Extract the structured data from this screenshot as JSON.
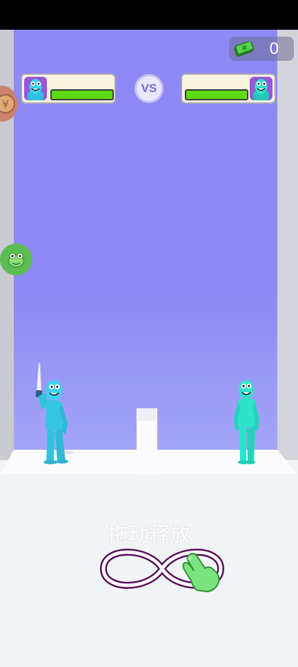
{
  "hud": {
    "money_icon": "cash-icon",
    "money_value": "0",
    "vs_label": "VS"
  },
  "player": {
    "hp_fraction": 1.0,
    "avatar_color": "#9a56d6",
    "body_color": "#3ccde3"
  },
  "enemy": {
    "hp_fraction": 1.0,
    "avatar_color": "#9a56d6",
    "body_color": "#2ee3cc"
  },
  "side_icons": [
    "coins-icon",
    "frog-icon"
  ],
  "tutorial": {
    "hint": "拖动释放",
    "gesture_icon": "infinity-swipe-hand-icon"
  },
  "colors": {
    "sky": "#8f89f7",
    "health": "#5ddb12",
    "gesture_stroke": "#5a0c5a",
    "hand": "#7be37d"
  }
}
